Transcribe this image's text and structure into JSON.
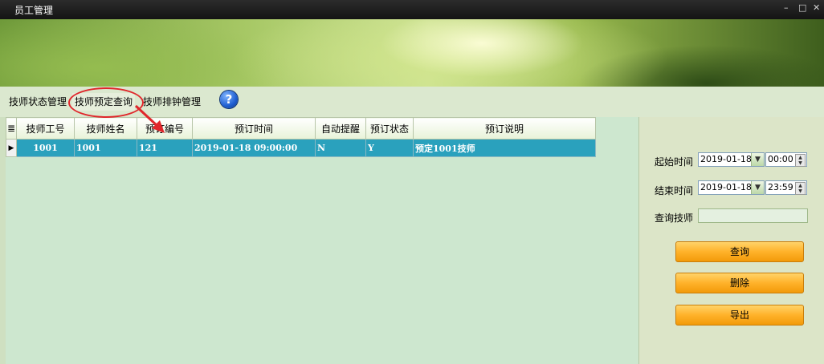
{
  "window": {
    "title": "员工管理",
    "minimize": "–",
    "restore": "□",
    "close": "✕"
  },
  "tabs": [
    {
      "label": "技师状态管理"
    },
    {
      "label": "技师预定查询"
    },
    {
      "label": "技师排钟管理"
    }
  ],
  "help_icon": "?",
  "grid": {
    "columns": [
      "技师工号",
      "技师姓名",
      "预订编号",
      "预订时间",
      "自动提醒",
      "预订状态",
      "预订说明"
    ],
    "rows": [
      {
        "indicator": "▶",
        "cells": [
          "1001",
          "1001",
          "121",
          "2019-01-18 09:00:00",
          "N",
          "Y",
          "预定1001技师"
        ]
      }
    ]
  },
  "filters": {
    "start_label": "起始时间",
    "start_date": "2019-01-18",
    "start_time": "00:00",
    "end_label": "结束时间",
    "end_date": "2019-01-18",
    "end_time": "23:59",
    "tech_label": "查询技师",
    "tech_value": ""
  },
  "buttons": {
    "query": "查询",
    "delete": "删除",
    "export": "导出"
  },
  "colors": {
    "selected_row": "#2aa1bd",
    "button": "#ffb22a",
    "annotation": "#e0262b"
  }
}
